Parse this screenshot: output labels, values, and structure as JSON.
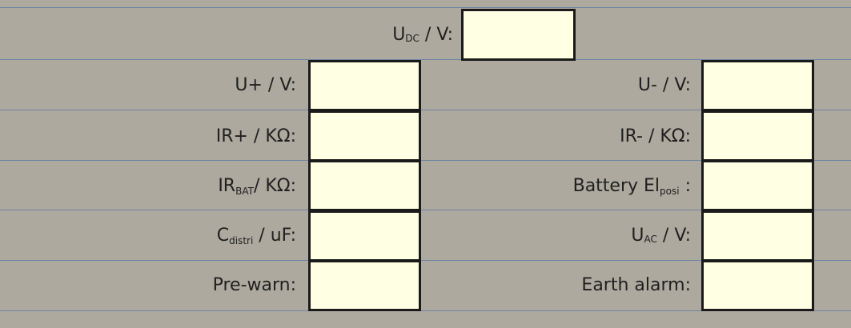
{
  "udc": {
    "main": "U",
    "sub": "DC",
    "unit": " / V:",
    "value": ""
  },
  "left": [
    {
      "main": "U+ / V:",
      "sub": "",
      "unit": "",
      "value": ""
    },
    {
      "main": "IR+ / KΩ:",
      "sub": "",
      "unit": "",
      "value": ""
    },
    {
      "main": "IR",
      "sub": "BAT",
      "unit": "/ KΩ:",
      "value": ""
    },
    {
      "main": "C",
      "sub": "distri",
      "unit": " / uF:",
      "value": ""
    },
    {
      "main": "Pre-warn:",
      "sub": "",
      "unit": "",
      "value": ""
    }
  ],
  "right": [
    {
      "main": "U- / V:",
      "sub": "",
      "unit": "",
      "value": ""
    },
    {
      "main": "IR- / KΩ:",
      "sub": "",
      "unit": "",
      "value": ""
    },
    {
      "main": "Battery El",
      "sub": "posi",
      "unit": " :",
      "value": ""
    },
    {
      "main": "U",
      "sub": "AC",
      "unit": " / V:",
      "value": ""
    },
    {
      "main": "Earth alarm:",
      "sub": "",
      "unit": "",
      "value": ""
    }
  ],
  "colors": {
    "background": "#ada99e",
    "value_box": "#ffffe3",
    "box_border": "#1a1a1a",
    "grid_line": "#6e84a3"
  }
}
